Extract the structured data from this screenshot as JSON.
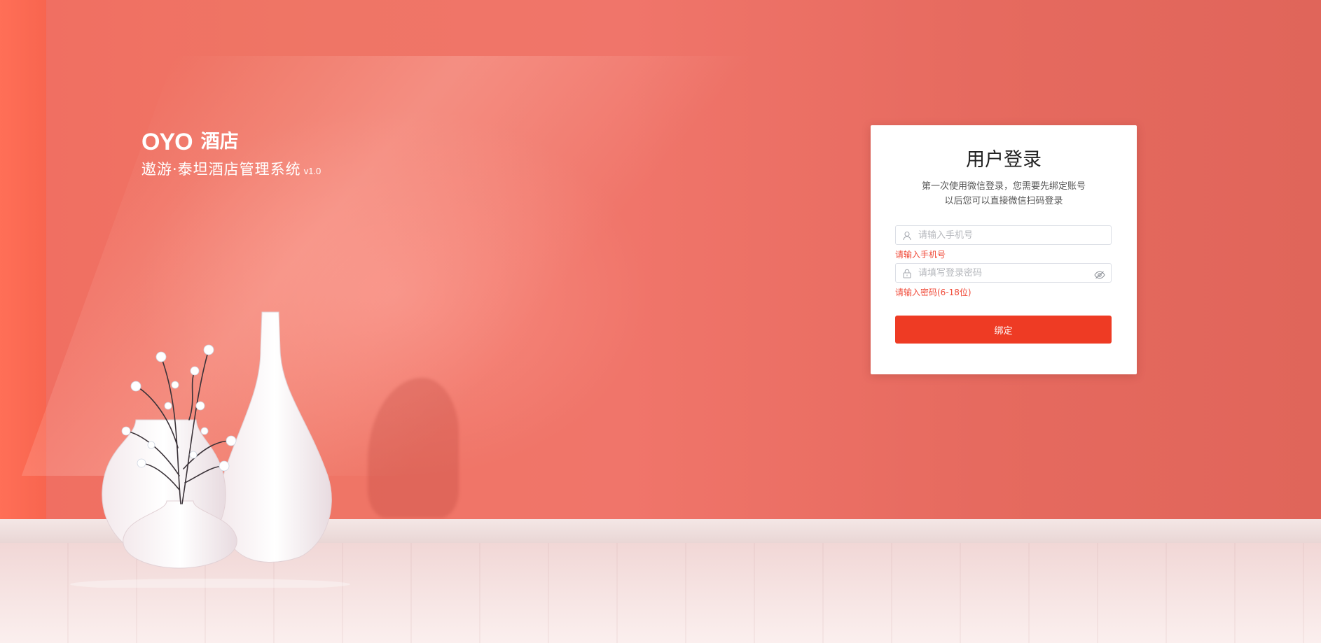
{
  "brand": {
    "logo_text": "OYO",
    "logo_cn": "酒店",
    "system_name": "遨游·泰坦酒店管理系统",
    "version": "v1.0"
  },
  "login": {
    "title": "用户登录",
    "desc_line1": "第一次使用微信登录，您需要先绑定账号",
    "desc_line2": "以后您可以直接微信扫码登录",
    "phone": {
      "placeholder": "请输入手机号",
      "value": "",
      "error": "请输入手机号"
    },
    "password": {
      "placeholder": "请填写登录密码",
      "value": "",
      "error": "请输入密码(6-18位)"
    },
    "submit_label": "绑定"
  },
  "colors": {
    "wall": "#ec6f61",
    "accent_button": "#ee3b24",
    "error_text": "#f04a38",
    "card_bg": "#ffffff"
  },
  "icons": {
    "phone_field": "user-icon",
    "password_field": "lock-icon",
    "password_toggle": "eye-slash-icon"
  }
}
